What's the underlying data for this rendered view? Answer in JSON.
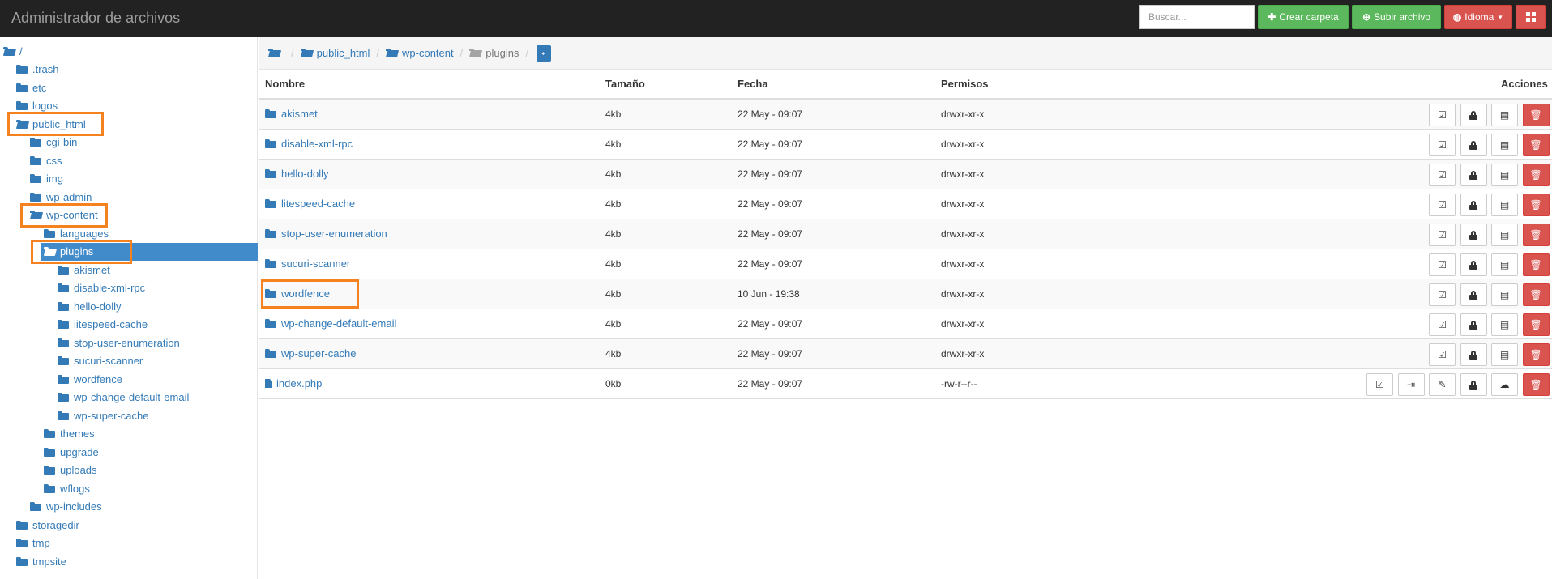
{
  "header": {
    "title": "Administrador de archivos",
    "search_placeholder": "Buscar...",
    "create_folder": "Crear carpeta",
    "upload_file": "Subir archivo",
    "language": "Idioma"
  },
  "tree": [
    {
      "label": "/",
      "level": 0,
      "open": true
    },
    {
      "label": ".trash",
      "level": 1
    },
    {
      "label": "etc",
      "level": 1
    },
    {
      "label": "logos",
      "level": 1
    },
    {
      "label": "public_html",
      "level": 1,
      "open": true,
      "highlight": true
    },
    {
      "label": "cgi-bin",
      "level": 2
    },
    {
      "label": "css",
      "level": 2
    },
    {
      "label": "img",
      "level": 2
    },
    {
      "label": "wp-admin",
      "level": 2
    },
    {
      "label": "wp-content",
      "level": 2,
      "open": true,
      "highlight": true
    },
    {
      "label": "languages",
      "level": 3
    },
    {
      "label": "plugins",
      "level": 3,
      "open": true,
      "selected": true,
      "highlight": true
    },
    {
      "label": "akismet",
      "level": 4
    },
    {
      "label": "disable-xml-rpc",
      "level": 4
    },
    {
      "label": "hello-dolly",
      "level": 4
    },
    {
      "label": "litespeed-cache",
      "level": 4
    },
    {
      "label": "stop-user-enumeration",
      "level": 4
    },
    {
      "label": "sucuri-scanner",
      "level": 4
    },
    {
      "label": "wordfence",
      "level": 4
    },
    {
      "label": "wp-change-default-email",
      "level": 4
    },
    {
      "label": "wp-super-cache",
      "level": 4
    },
    {
      "label": "themes",
      "level": 3
    },
    {
      "label": "upgrade",
      "level": 3
    },
    {
      "label": "uploads",
      "level": 3
    },
    {
      "label": "wflogs",
      "level": 3
    },
    {
      "label": "wp-includes",
      "level": 2
    },
    {
      "label": "storagedir",
      "level": 1
    },
    {
      "label": "tmp",
      "level": 1
    },
    {
      "label": "tmpsite",
      "level": 1
    }
  ],
  "breadcrumb": {
    "items": [
      "public_html",
      "wp-content"
    ],
    "current": "plugins"
  },
  "table": {
    "headers": {
      "name": "Nombre",
      "size": "Tamaño",
      "date": "Fecha",
      "perms": "Permisos",
      "actions": "Acciones"
    },
    "rows": [
      {
        "name": "akismet",
        "size": "4kb",
        "date": "22 May - 09:07",
        "perms": "drwxr-xr-x",
        "type": "folder"
      },
      {
        "name": "disable-xml-rpc",
        "size": "4kb",
        "date": "22 May - 09:07",
        "perms": "drwxr-xr-x",
        "type": "folder"
      },
      {
        "name": "hello-dolly",
        "size": "4kb",
        "date": "22 May - 09:07",
        "perms": "drwxr-xr-x",
        "type": "folder"
      },
      {
        "name": "litespeed-cache",
        "size": "4kb",
        "date": "22 May - 09:07",
        "perms": "drwxr-xr-x",
        "type": "folder"
      },
      {
        "name": "stop-user-enumeration",
        "size": "4kb",
        "date": "22 May - 09:07",
        "perms": "drwxr-xr-x",
        "type": "folder"
      },
      {
        "name": "sucuri-scanner",
        "size": "4kb",
        "date": "22 May - 09:07",
        "perms": "drwxr-xr-x",
        "type": "folder"
      },
      {
        "name": "wordfence",
        "size": "4kb",
        "date": "10 Jun - 19:38",
        "perms": "drwxr-xr-x",
        "type": "folder",
        "highlight": true
      },
      {
        "name": "wp-change-default-email",
        "size": "4kb",
        "date": "22 May - 09:07",
        "perms": "drwxr-xr-x",
        "type": "folder"
      },
      {
        "name": "wp-super-cache",
        "size": "4kb",
        "date": "22 May - 09:07",
        "perms": "drwxr-xr-x",
        "type": "folder"
      },
      {
        "name": "index.php",
        "size": "0kb",
        "date": "22 May - 09:07",
        "perms": "-rw-r--r--",
        "type": "file"
      }
    ]
  },
  "colors": {
    "topbar": "#222222",
    "link": "#337ab7",
    "selected": "#428bca",
    "highlight": "#f5821f",
    "success": "#5cb85c",
    "danger": "#d9534f"
  },
  "icons": {
    "folder_actions": [
      "rename-icon",
      "lock-icon",
      "archive-icon",
      "trash-icon"
    ],
    "file_actions": [
      "rename-icon",
      "move-icon",
      "edit-icon",
      "lock-icon",
      "download-icon",
      "trash-icon"
    ]
  }
}
